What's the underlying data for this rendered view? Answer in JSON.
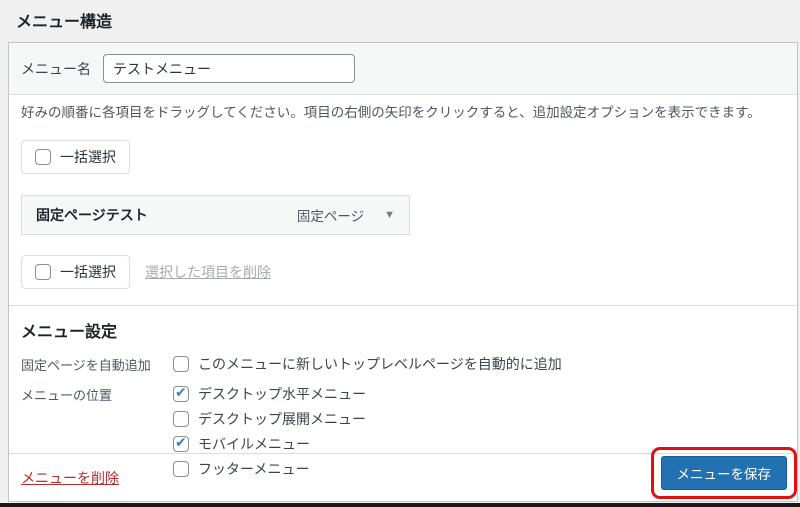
{
  "page": {
    "title": "メニュー構造"
  },
  "menu_name": {
    "label": "メニュー名",
    "value": "テストメニュー"
  },
  "instructions": "好みの順番に各項目をドラッグしてください。項目の右側の矢印をクリックすると、追加設定オプションを表示できます。",
  "bulk_select_top": {
    "label": "一括選択",
    "checked": false
  },
  "menu_item": {
    "title": "固定ページテスト",
    "type": "固定ページ",
    "expand_icon": "▼"
  },
  "bulk_select_bottom": {
    "label": "一括選択",
    "checked": false,
    "remove_link": "選択した項目を削除"
  },
  "settings": {
    "title": "メニュー設定",
    "auto_add": {
      "label": "固定ページを自動追加",
      "option": "このメニューに新しいトップレベルページを自動的に追加",
      "checked": false
    },
    "display_location": {
      "label": "メニューの位置",
      "options": [
        {
          "label": "デスクトップ水平メニュー",
          "checked": true
        },
        {
          "label": "デスクトップ展開メニュー",
          "checked": false
        },
        {
          "label": "モバイルメニュー",
          "checked": true
        },
        {
          "label": "フッターメニュー",
          "checked": false
        }
      ]
    }
  },
  "footer": {
    "delete_label": "メニューを削除",
    "save_label": "メニューを保存"
  },
  "colors": {
    "accent_blue": "#2271b1",
    "check_blue": "#3582c4",
    "delete_red": "#b32d2e",
    "annotation_red": "#e01010",
    "panel_border": "#c3c4c7"
  }
}
